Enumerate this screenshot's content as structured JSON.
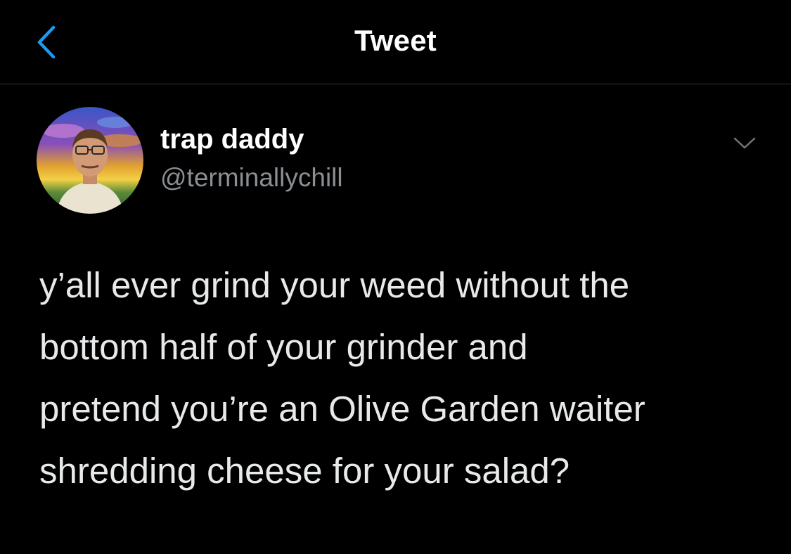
{
  "nav": {
    "title": "Tweet",
    "back_icon": "chevron-left-icon",
    "accent_color": "#1d9bf0"
  },
  "tweet": {
    "author": {
      "display_name": "trap daddy",
      "handle": "@terminallychill",
      "avatar_icon": "avatar"
    },
    "menu_icon": "chevron-down-icon",
    "text_lines": [
      "y’all ever grind your weed without the",
      "bottom half of your grinder and",
      "pretend you’re an Olive Garden waiter",
      "shredding cheese for your salad?"
    ]
  },
  "colors": {
    "background": "#000000",
    "primary_text": "#e7e9ea",
    "secondary_text": "#8b8f93",
    "divider": "#2f3336"
  }
}
